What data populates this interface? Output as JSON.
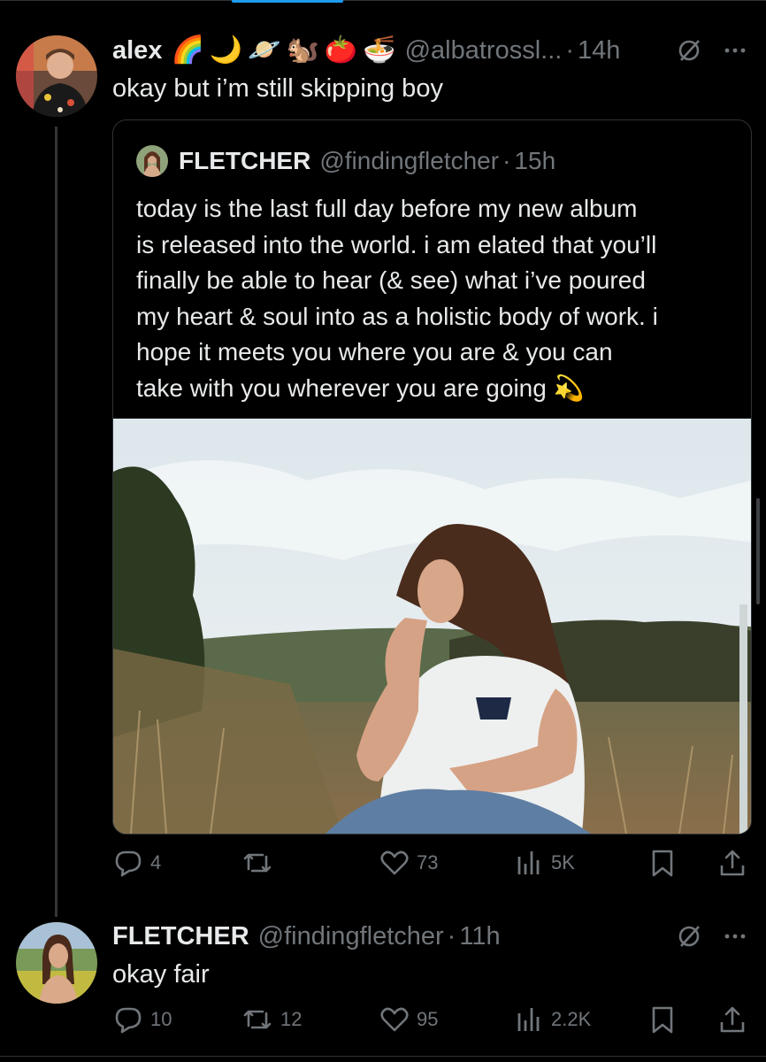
{
  "tweet": {
    "author_name": "alex",
    "emojis": [
      "🌈",
      "🌙",
      "🪐",
      "🐿️",
      "🍅",
      "🍜"
    ],
    "handle": "@albatrossl...",
    "separator": "·",
    "time": "14h",
    "text": "okay but i’m still skipping boy",
    "stats": {
      "replies": "4",
      "reposts": "",
      "likes": "73",
      "views": "5K"
    }
  },
  "quoted": {
    "author_name": "FLETCHER",
    "handle": "@findingfletcher",
    "separator": "·",
    "time": "15h",
    "text_lines": [
      "today is the last full day before my new album",
      "is released into the world. i am elated that you’ll",
      "finally be able to hear (& see) what i’ve poured",
      "my heart & soul into as a holistic body of work. i",
      "hope it meets you where you are & you can",
      "take with you wherever you are going"
    ],
    "trailing_emoji": "💫"
  },
  "reply": {
    "author_name": "FLETCHER",
    "handle": "@findingfletcher",
    "separator": "·",
    "time": "11h",
    "text": "okay fair",
    "stats": {
      "replies": "10",
      "reposts": "12",
      "likes": "95",
      "views": "2.2K"
    }
  },
  "icons": {
    "more": "more-horizontal-icon",
    "grok": "grok-slash-icon",
    "reply": "reply-bubble-icon",
    "repost": "repost-arrows-icon",
    "like": "heart-icon",
    "views": "views-bars-icon",
    "bookmark": "bookmark-icon",
    "share": "share-upload-icon"
  },
  "colors": {
    "background": "#000000",
    "text": "#e7e9ea",
    "muted": "#71767b",
    "border": "#2f3336",
    "accent": "#1d9bf0"
  }
}
